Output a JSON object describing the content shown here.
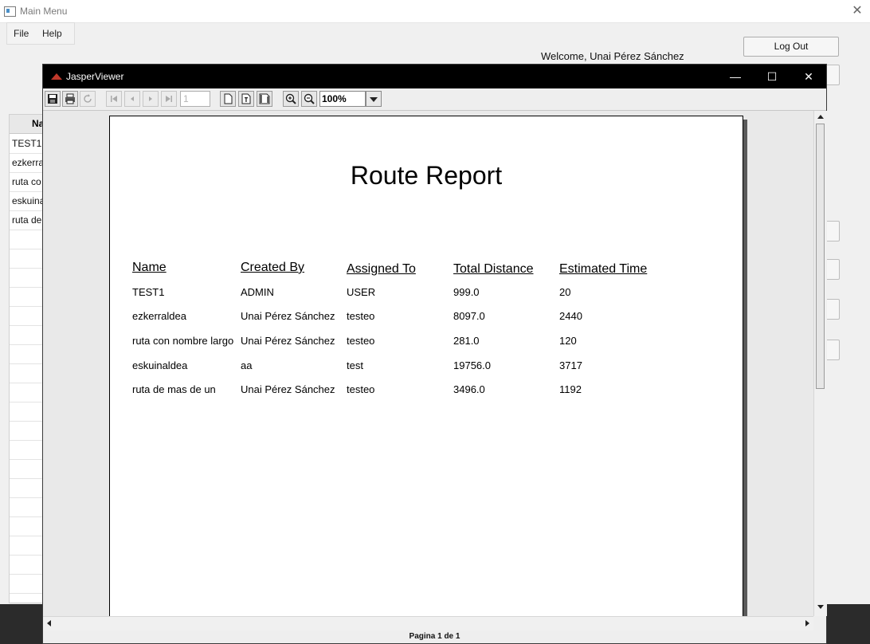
{
  "main_window": {
    "title": "Main Menu",
    "close_glyph": "✕",
    "menu": [
      "File",
      "Help"
    ],
    "welcome": "Welcome, Unai Pérez Sánchez",
    "logout_label": "Log Out",
    "table_header": "Na",
    "table_rows": [
      "TEST1",
      "ezkerra",
      "ruta co",
      "eskuina",
      "ruta de"
    ]
  },
  "viewer": {
    "title": "JasperViewer",
    "controls": {
      "minimize": "—",
      "maximize": "☐",
      "close": "✕"
    },
    "toolbar": {
      "icons": [
        "save-icon",
        "print-icon",
        "reload-icon",
        "first-page-icon",
        "previous-page-icon",
        "next-page-icon",
        "last-page-icon",
        "actual-size-icon",
        "fit-page-icon",
        "fit-width-icon",
        "zoom-in-icon",
        "zoom-out-icon"
      ],
      "page_number": "1",
      "zoom": "100%"
    },
    "status": "Pagina 1 de 1"
  },
  "report": {
    "title": "Route Report",
    "columns": [
      "Name",
      "Created By",
      "Assigned To",
      "Total Distance",
      "Estimated Time"
    ],
    "rows": [
      [
        "TEST1",
        "ADMIN",
        "USER",
        "999.0",
        "20"
      ],
      [
        "ezkerraldea",
        "Unai Pérez Sánchez",
        "testeo",
        "8097.0",
        "2440"
      ],
      [
        "ruta con nombre largo",
        "Unai Pérez Sánchez",
        "testeo",
        "281.0",
        "120"
      ],
      [
        "eskuinaldea",
        "aa",
        "test",
        "19756.0",
        "3717"
      ],
      [
        "ruta de mas de un",
        "Unai Pérez Sánchez",
        "testeo",
        "3496.0",
        "1192"
      ]
    ]
  }
}
